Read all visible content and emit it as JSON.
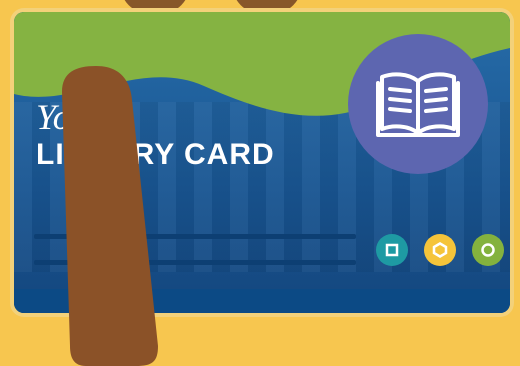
{
  "card": {
    "title_line1": "Your",
    "title_line2": "LIBRARY CARD"
  },
  "colors": {
    "background": "#f7c64f",
    "card_blue": "#1f5f9a",
    "green_wave": "#85b342",
    "badge": "#5d66b0",
    "teal_dot": "#1e9aa3",
    "yellow_dot": "#f5c43a",
    "green_dot": "#84b23e",
    "finger": "#8b5228"
  },
  "icons": [
    "open-book-icon",
    "square-icon",
    "hexagon-icon",
    "circle-icon"
  ]
}
